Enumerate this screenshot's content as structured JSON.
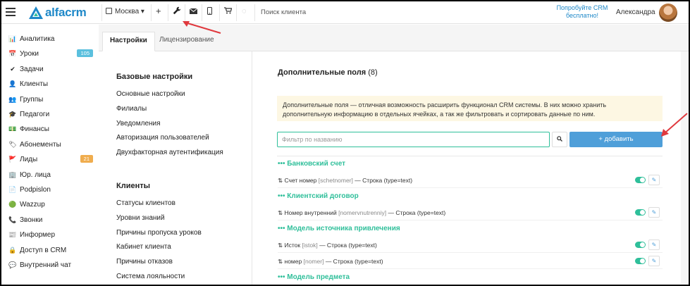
{
  "topbar": {
    "logo_text": "alfacrm",
    "city": "Москва",
    "search_placeholder": "Поиск клиента",
    "try_free": "Попробуйте CRM бесплатно!",
    "user_name": "Александра"
  },
  "sidebar": {
    "items": [
      {
        "icon": "📊",
        "label": "Аналитика"
      },
      {
        "icon": "📅",
        "label": "Уроки",
        "badge": "105",
        "badge_color": "#5bc0de"
      },
      {
        "icon": "✔",
        "label": "Задачи"
      },
      {
        "icon": "👤",
        "label": "Клиенты"
      },
      {
        "icon": "👥",
        "label": "Группы"
      },
      {
        "icon": "🎓",
        "label": "Педагоги"
      },
      {
        "icon": "💵",
        "label": "Финансы"
      },
      {
        "icon": "🏷",
        "label": "Абонементы"
      },
      {
        "icon": "🚩",
        "label": "Лиды",
        "badge": "21",
        "badge_color": "#f0ad4e"
      },
      {
        "icon": "🏢",
        "label": "Юр. лица"
      },
      {
        "icon": "📄",
        "label": "Podpislon"
      },
      {
        "icon": "🟢",
        "label": "Wazzup"
      },
      {
        "icon": "📞",
        "label": "Звонки"
      },
      {
        "icon": "📰",
        "label": "Информер"
      },
      {
        "icon": "🔒",
        "label": "Доступ в CRM"
      },
      {
        "icon": "💬",
        "label": "Внутренний чат"
      }
    ]
  },
  "tabs": [
    {
      "label": "Настройки",
      "active": true
    },
    {
      "label": "Лицензирование",
      "active": false
    }
  ],
  "settings": {
    "groups": [
      {
        "title": "Базовые настройки",
        "links": [
          "Основные настройки",
          "Филиалы",
          "Уведомления",
          "Авторизация пользователей",
          "Двухфакторная аутентификация"
        ]
      },
      {
        "title": "Клиенты",
        "links": [
          "Статусы клиентов",
          "Уровни знаний",
          "Причины пропуска уроков",
          "Кабинет клиента",
          "Причины отказов",
          "Система лояльности"
        ]
      }
    ]
  },
  "main": {
    "title": "Дополнительные поля",
    "count": "(8)",
    "notice": "Дополнительные поля — отличная возможность расширить функционал CRM системы. В них можно хранить дополнительную информацию в отдельных ячейках, а так же фильтровать и сортировать данные по ним.",
    "filter_placeholder": "Фильтр по названию",
    "add_label": "+ добавить",
    "sections": [
      {
        "title": "••• Банковский счет",
        "fields": [
          {
            "name": "Счет номер",
            "code": "[schetnomer]",
            "type": "— Строка (type=text)"
          }
        ]
      },
      {
        "title": "••• Клиентский договор",
        "fields": [
          {
            "name": "Номер внутренний",
            "code": "[nomervnutrenniy]",
            "type": "— Строка (type=text)"
          }
        ]
      },
      {
        "title": "••• Модель источника привлечения",
        "fields": [
          {
            "name": "Исток",
            "code": "[istok]",
            "type": "— Строка (type=text)"
          },
          {
            "name": "номер",
            "code": "[nomer]",
            "type": "— Строка (type=text)"
          }
        ]
      },
      {
        "title": "••• Модель предмета",
        "fields": []
      }
    ]
  },
  "colors": {
    "accent_green": "#2fbf9a",
    "accent_blue": "#4f9fd9",
    "annotation_red": "#e0393e"
  }
}
